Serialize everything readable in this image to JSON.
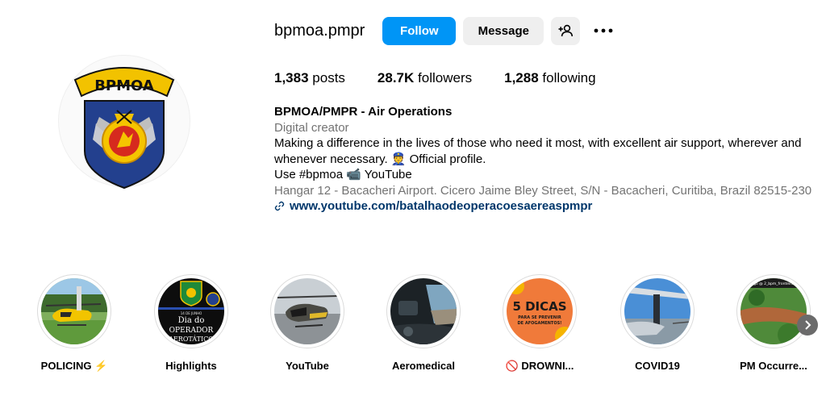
{
  "profile": {
    "username": "bpmoa.pmpr",
    "follow_label": "Follow",
    "message_label": "Message",
    "logo_text": "BPMOA",
    "stats": {
      "posts_count": "1,383",
      "posts_label": "posts",
      "followers_count": "28.7K",
      "followers_label": "followers",
      "following_count": "1,288",
      "following_label": "following"
    },
    "bio": {
      "name": "BPMOA/PMPR - Air Operations",
      "category": "Digital creator",
      "line1": "Making a difference in the lives of those who need it most, with excellent air support, wherever and whenever necessary. 👮 Official profile.",
      "line2": "Use #bpmoa 📹 YouTube",
      "address": "Hangar 12 - Bacacheri Airport. Cicero Jaime Bley Street, S/N - Bacacheri, Curitiba, Brazil 82515-230",
      "link": "www.youtube.com/batalhaodeoperacoesaereaspmpr"
    }
  },
  "highlights": [
    {
      "label": "POLICING ⚡"
    },
    {
      "label": "Highlights",
      "img_text_small": "14 DE JUNHO",
      "img_text_1": "Dia do",
      "img_text_2": "OPERADOR",
      "img_text_3": "AEROTÁTICO"
    },
    {
      "label": "YouTube"
    },
    {
      "label": "Aeromedical"
    },
    {
      "label": "🚫 DROWNI...",
      "img_text_1": "5 DICAS",
      "img_text_2": "PARA SE PREVENIR",
      "img_text_3": "DE AFOGAMENTOS!"
    },
    {
      "label": "COVID19"
    },
    {
      "label": "PM Occurre...",
      "img_text_small": "go @ 2_bpm_fronteira"
    }
  ],
  "colors": {
    "accent": "#0095f6",
    "link": "#00376b",
    "secondary_text": "#737373"
  },
  "icons": {
    "add_user": "person-plus-icon",
    "more": "more-horizontal-icon",
    "link": "link-chain-icon",
    "next": "chevron-right-icon"
  }
}
